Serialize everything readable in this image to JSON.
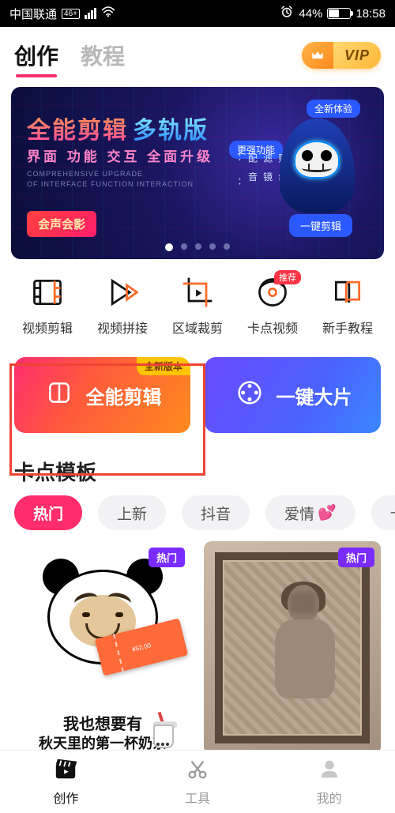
{
  "status": {
    "carrier": "中国联通",
    "net_badge": "46+",
    "battery_pct": "44%",
    "time": "18:58"
  },
  "tabs": {
    "create": "创作",
    "tutorial": "教程"
  },
  "vip": {
    "label": "VIP"
  },
  "banner": {
    "title_a": "全能剪辑",
    "title_b": "多轨版",
    "subtitle": "界面  功能  交互  全面升级",
    "en1": "COMPREHENSIVE UPGRADE",
    "en2": "OF INTERFACE FUNCTION INTERACTION",
    "red_pill": "会声会影",
    "pill_new": "全新体验",
    "pill_more": "更强功能",
    "pill_one": "一键剪辑",
    "vert": "文 字\n贴 纸\n滤 镜\n配 音\n：  ："
  },
  "tools": {
    "t1": "视频剪辑",
    "t2": "视频拼接",
    "t3": "区域裁剪",
    "t4": "卡点视频",
    "t4_badge": "推荐",
    "t5": "新手教程"
  },
  "cards": {
    "a": "全能剪辑",
    "a_corner": "全新版本",
    "b": "一键大片"
  },
  "section": {
    "title": "卡点模板"
  },
  "chips": {
    "c1": "热门",
    "c2": "上新",
    "c3": "抖音",
    "c4": "爱情",
    "c5": "卡点"
  },
  "templates": {
    "hot": "热门",
    "a_line1": "我也想要有",
    "a_line2": "秋天里的第一杯奶茶",
    "ticket": "¥52.00"
  },
  "nav": {
    "n1": "创作",
    "n2": "工具",
    "n3": "我的"
  }
}
